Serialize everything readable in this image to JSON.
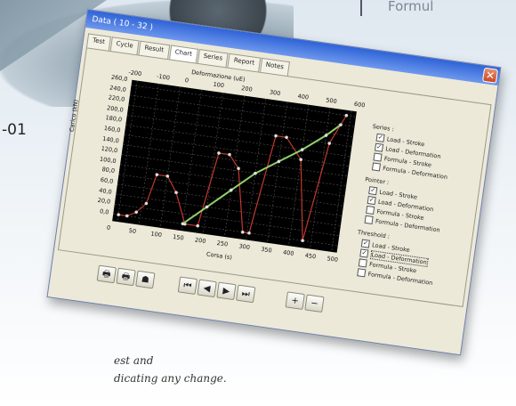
{
  "background": {
    "heading": "Formul",
    "code": "-01",
    "caption": [
      "est and",
      "dicating any change."
    ]
  },
  "window": {
    "title": "Data ( 10 - 32 )",
    "close_icon": "close-icon",
    "tabs": [
      "Test",
      "Cycle",
      "Result",
      "Chart",
      "Series",
      "Report",
      "Notes"
    ],
    "active_tab": "Chart"
  },
  "chart_data": {
    "type": "line",
    "top_axis_label": "Deformazione (uE)",
    "top_ticks": [
      "-200",
      "-100",
      "0",
      "100",
      "200",
      "300",
      "400",
      "500",
      "600"
    ],
    "ylabel": "Carico (kN)",
    "y_ticks": [
      "260,0",
      "240,0",
      "220,0",
      "200,0",
      "180,0",
      "160,0",
      "140,0",
      "120,0",
      "100,0",
      "80,0",
      "60,0",
      "40,0",
      "20,0",
      "0,0"
    ],
    "xlabel": "Corsa (s)",
    "x_ticks": [
      "0",
      "50",
      "100",
      "150",
      "200",
      "250",
      "300",
      "350",
      "400",
      "450",
      "500"
    ],
    "xlim": [
      0,
      500
    ],
    "ylim": [
      0,
      260
    ],
    "grid": true,
    "series": [
      {
        "color": "#c0392b",
        "x": [
          0,
          20,
          40,
          60,
          75,
          100,
          125,
          155,
          185,
          210,
          235,
          260,
          290,
          305,
          335,
          360,
          400,
          430,
          460,
          490
        ],
        "y": [
          0,
          0,
          10,
          30,
          90,
          90,
          60,
          0,
          0,
          150,
          150,
          125,
          0,
          0,
          200,
          200,
          160,
          0,
          200,
          260
        ]
      },
      {
        "color": "#8fd16a",
        "x": [
          150,
          200,
          250,
          300,
          350,
          400,
          450,
          480
        ],
        "y": [
          0,
          40,
          80,
          120,
          150,
          180,
          215,
          240
        ]
      }
    ]
  },
  "side_panel": {
    "groups": [
      {
        "title": "Series :",
        "options": [
          {
            "label": "Load - Stroke",
            "checked": true
          },
          {
            "label": "Load - Deformation",
            "checked": true
          },
          {
            "label": "Formula - Stroke",
            "checked": false
          },
          {
            "label": "Formula - Deformation",
            "checked": false
          }
        ]
      },
      {
        "title": "Pointer :",
        "options": [
          {
            "label": "Load - Stroke",
            "checked": true
          },
          {
            "label": "Load - Deformation",
            "checked": true
          },
          {
            "label": "Formula - Stroke",
            "checked": false
          },
          {
            "label": "Formula - Deformation",
            "checked": false
          }
        ]
      },
      {
        "title": "Threshold :",
        "options": [
          {
            "label": "Load - Stroke",
            "checked": true
          },
          {
            "label": "Load - Deformation",
            "checked": true
          },
          {
            "label": "Formula - Stroke",
            "checked": false
          },
          {
            "label": "Formula - Deformation",
            "checked": false
          }
        ]
      }
    ]
  },
  "toolbar": {
    "icons": [
      "print-icon",
      "print-preview-icon",
      "export-icon"
    ],
    "print_glyph": "🖶",
    "preview_glyph": "🖶",
    "export_glyph": "☗",
    "nav_first": "⏮",
    "nav_prev": "◀",
    "nav_next": "▶",
    "nav_last": "⏭",
    "zoom_in": "+",
    "zoom_out": "−"
  }
}
